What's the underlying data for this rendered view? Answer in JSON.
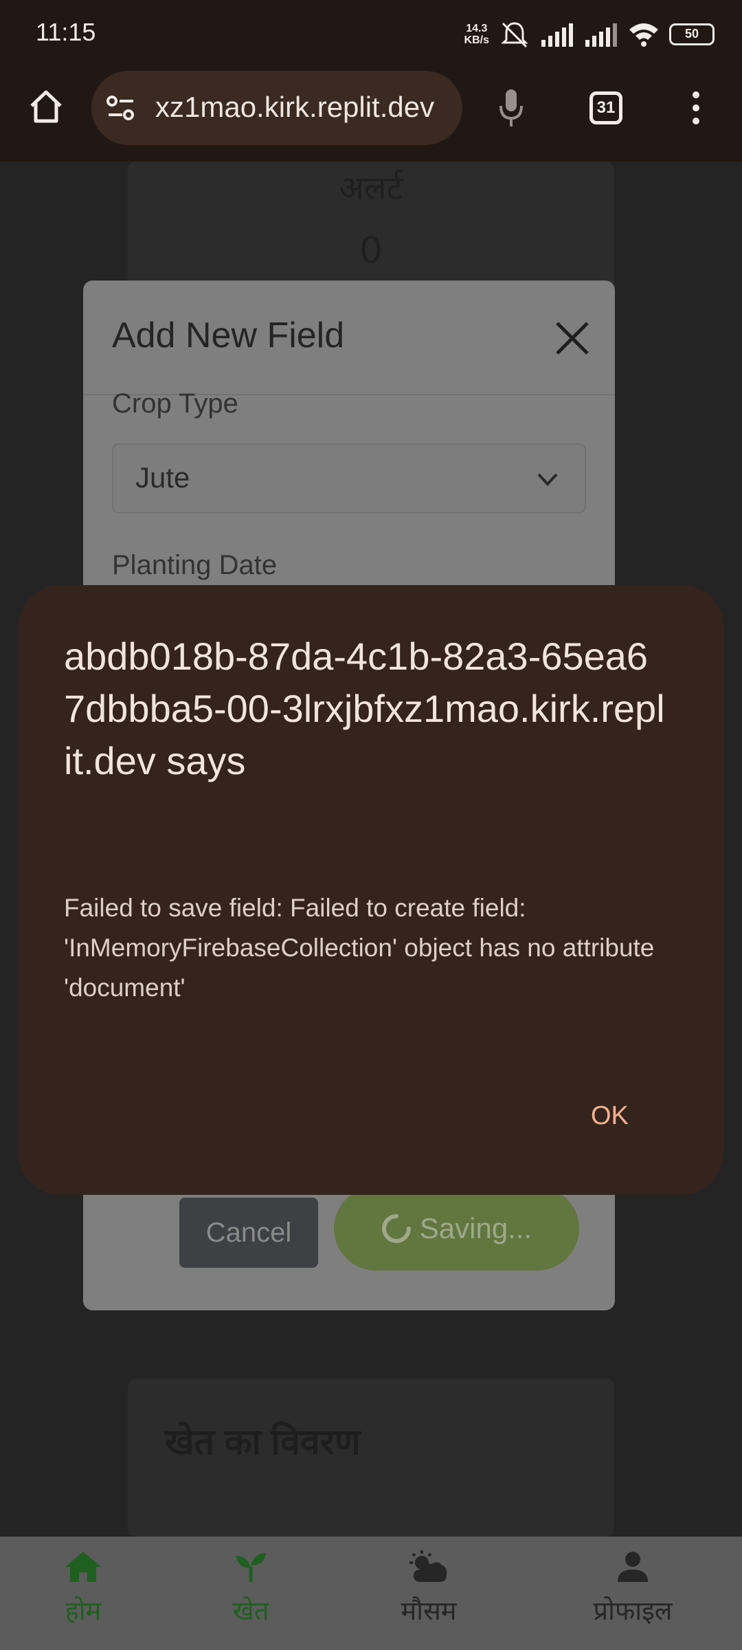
{
  "status_bar": {
    "time": "11:15",
    "net_speed_value": "14.3",
    "net_speed_unit": "KB/s",
    "battery": "50"
  },
  "browser": {
    "url": "xz1mao.kirk.replit.dev",
    "tab_count": "31"
  },
  "page": {
    "alert_title": "अलर्ट",
    "alert_count": "0",
    "details_title": "खेत का विवरण"
  },
  "modal": {
    "title": "Add New Field",
    "crop_type_label": "Crop Type",
    "crop_type_value": "Jute",
    "planting_date_label": "Planting Date",
    "cancel_label": "Cancel",
    "saving_label": "Saving..."
  },
  "dialog": {
    "title": "abdb018b-87da-4c1b-82a3-65ea67dbbba5-00-3lrxjbfxz1mao.kirk.replit.dev says",
    "message": "Failed to save field: Failed to create field: 'InMemoryFirebaseCollection' object has no attribute 'document'",
    "ok_label": "OK"
  },
  "bottom_nav": [
    {
      "label": "होम",
      "icon": "home-icon",
      "color": "#1f5f1f"
    },
    {
      "label": "खेत",
      "icon": "sprout-icon",
      "color": "#1f5f1f"
    },
    {
      "label": "मौसम",
      "icon": "weather-icon",
      "color": "#262626"
    },
    {
      "label": "प्रोफाइल",
      "icon": "profile-icon",
      "color": "#262626"
    }
  ]
}
